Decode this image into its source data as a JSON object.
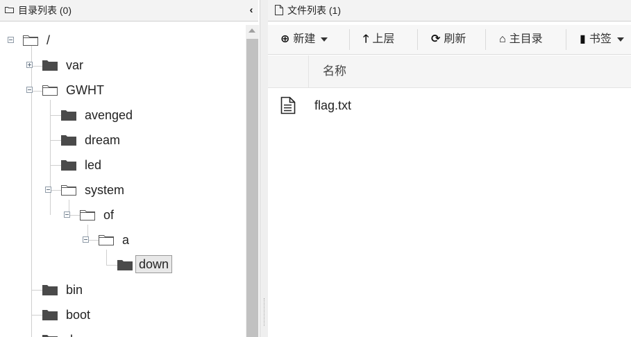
{
  "dir_panel": {
    "title": "目录列表 (0)",
    "collapse_glyph": "‹"
  },
  "tree": {
    "root": "/",
    "var": "var",
    "gwht": "GWHT",
    "avenged": "avenged",
    "dream": "dream",
    "led": "led",
    "system": "system",
    "of": "of",
    "a": "a",
    "down": "down",
    "bin": "bin",
    "boot": "boot",
    "partial_next": "d"
  },
  "file_panel": {
    "title": "文件列表 (1)"
  },
  "toolbar": {
    "new_label": "新建",
    "up_label": "上层",
    "refresh_label": "刷新",
    "home_label": "主目录",
    "bookmark_label": "书签"
  },
  "table": {
    "name_header": "名称",
    "files": [
      {
        "name": "flag.txt",
        "icon": "text-file-icon"
      }
    ]
  },
  "icons": {
    "folder_closed": "folder-icon",
    "folder_open": "folder-open-icon",
    "new": "plus-circle-icon",
    "up": "arrow-up-icon",
    "refresh": "refresh-icon",
    "home": "home-icon",
    "bookmark": "bookmark-icon"
  },
  "colors": {
    "folder_fill": "#4a4a4a",
    "panel_header": "#f3f3f3",
    "selection_bg": "#e8e8e8"
  }
}
